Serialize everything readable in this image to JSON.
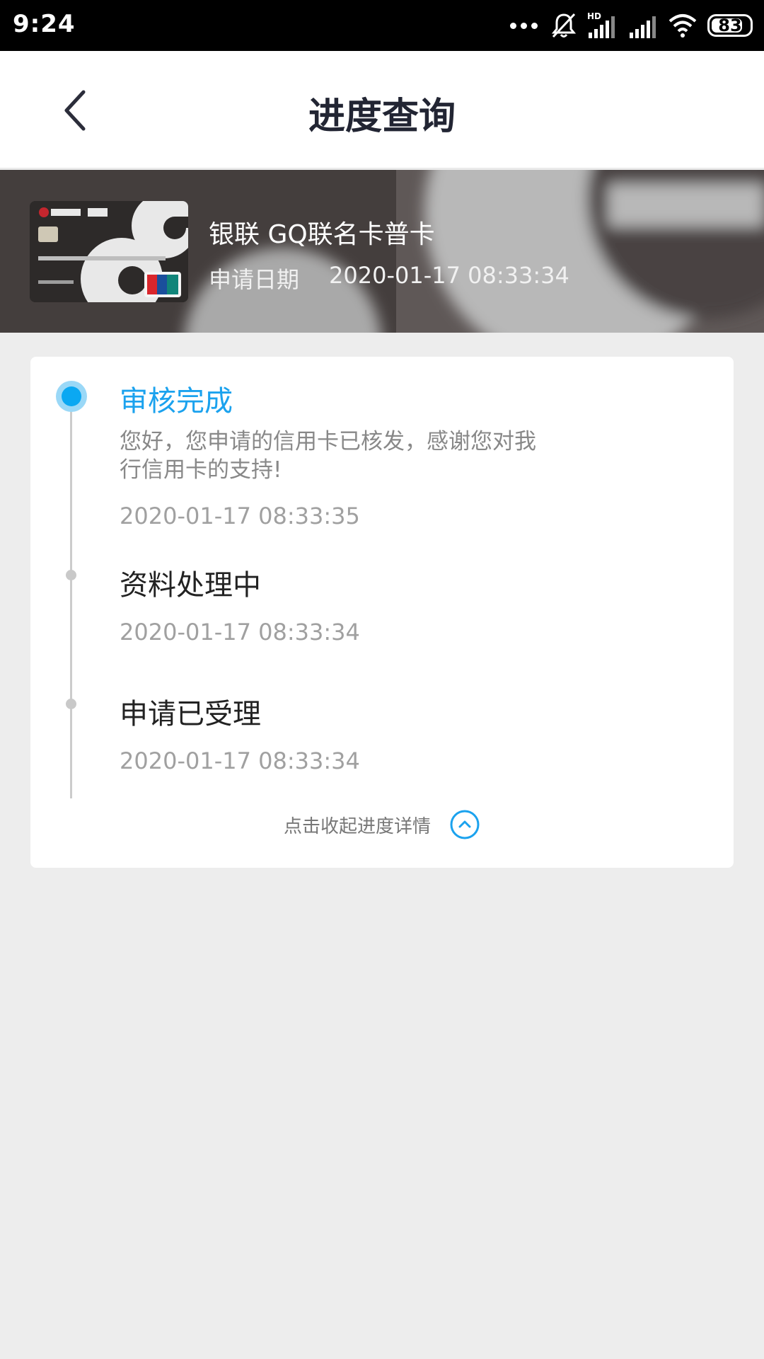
{
  "status_bar": {
    "time": "9:24",
    "battery": "83",
    "battery_level": 0.83,
    "icons": [
      "more-dots-icon",
      "notifications-muted-icon",
      "hd-signal-icon",
      "signal-icon",
      "wifi-icon",
      "battery-icon"
    ]
  },
  "nav": {
    "title": "进度查询",
    "back_icon": "chevron-left-icon"
  },
  "card": {
    "name": "银联 GQ联名卡普卡",
    "apply_date_label": "申请日期",
    "apply_date": "2020-01-17 08:33:34"
  },
  "progress": {
    "steps": [
      {
        "title": "审核完成",
        "description": "您好，您申请的信用卡已核发，感谢您对我行信用卡的支持!",
        "time": "2020-01-17 08:33:35",
        "active": true
      },
      {
        "title": "资料处理中",
        "time": "2020-01-17 08:33:34",
        "active": false
      },
      {
        "title": "申请已受理",
        "time": "2020-01-17 08:33:34",
        "active": false
      }
    ],
    "collapse_label": "点击收起进度详情",
    "collapse_icon": "chevron-up-circle-icon"
  },
  "colors": {
    "accent": "#1ba2ee",
    "background": "#ededed",
    "title_text": "#222533"
  }
}
